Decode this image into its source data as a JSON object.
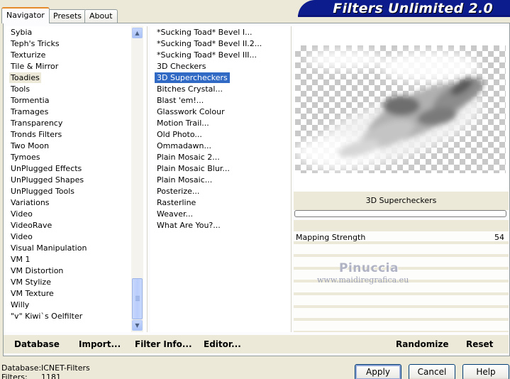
{
  "tabs": [
    "Navigator",
    "Presets",
    "About"
  ],
  "banner_title": "Filters Unlimited 2.0",
  "categories": [
    "Sybia",
    "Teph's Tricks",
    "Texturize",
    "Tile & Mirror",
    "Toadies",
    "Tools",
    "Tormentia",
    "Tramages",
    "Transparency",
    "Tronds Filters",
    "Two Moon",
    "Tymoes",
    "UnPlugged Effects",
    "UnPlugged Shapes",
    "UnPlugged Tools",
    "Variations",
    "Video",
    "VideoRave",
    "Video",
    "Visual Manipulation",
    "VM 1",
    "VM Distortion",
    "VM Stylize",
    "VM Texture",
    "Willy",
    "\"v\" Kiwi`s Oelfilter"
  ],
  "selected_category": "Toadies",
  "filters": [
    "*Sucking Toad*  Bevel I...",
    "*Sucking Toad*  Bevel II.2...",
    "*Sucking Toad*  Bevel III...",
    "3D Checkers",
    "3D Supercheckers",
    "Bitches Crystal...",
    "Blast 'em!...",
    "Glasswork Colour",
    "Motion Trail...",
    "Old Photo...",
    "Ommadawn...",
    "Plain Mosaic 2...",
    "Plain Mosaic Blur...",
    "Plain Mosaic...",
    "Posterize...",
    "Rasterline",
    "Weaver...",
    "What Are You?..."
  ],
  "selected_filter": "3D Supercheckers",
  "preview_label": "3D Supercheckers",
  "parameter": {
    "name": "Mapping Strength",
    "value": "54"
  },
  "watermark": {
    "name": "Pinuccia",
    "url": "www.maidiregrafica.eu"
  },
  "toolbar": {
    "database": "Database",
    "import": "Import...",
    "filter_info": "Filter Info...",
    "editor": "Editor...",
    "randomize": "Randomize",
    "reset": "Reset"
  },
  "status": {
    "database_label": "Database:",
    "database_value": "ICNET-Filters",
    "filters_label": "Filters:",
    "filters_value": "1181"
  },
  "buttons": {
    "apply": "Apply",
    "cancel": "Cancel",
    "help": "Help"
  },
  "colors": {
    "banner": "#0c1c8c",
    "selection": "#316ac5",
    "tab_accent": "#e68b2c"
  }
}
